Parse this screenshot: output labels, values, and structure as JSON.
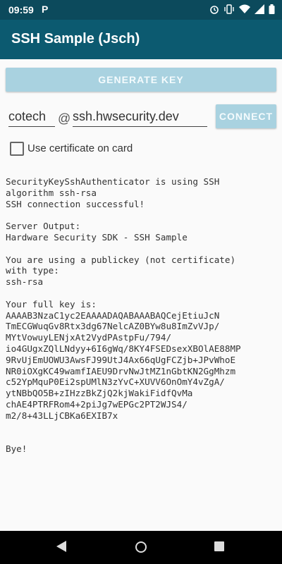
{
  "status": {
    "time": "09:59",
    "app_icon": "P",
    "icons": [
      "alarm-icon",
      "vibrate-icon",
      "wifi-icon",
      "signal-icon",
      "battery-icon"
    ]
  },
  "appbar": {
    "title": "SSH Sample (Jsch)"
  },
  "buttons": {
    "generate": "GENERATE KEY",
    "connect": "CONNECT"
  },
  "form": {
    "username": "cotech",
    "at": "@",
    "host": "ssh.hwsecurity.dev",
    "checkbox_label": "Use certificate on card",
    "checkbox_checked": false
  },
  "output": "SecurityKeySshAuthenticator is using SSH\nalgorithm ssh-rsa\nSSH connection successful!\n\nServer Output:\nHardware Security SDK - SSH Sample\n\nYou are using a publickey (not certificate)\nwith type:\nssh-rsa\n\nYour full key is:\nAAAAB3NzaC1yc2EAAAADAQABAAABAQCejEtiuJcN\nTmECGWuqGv8Rtx3dg67NelcAZ0BYw8u8ImZvVJp/\nMYtVowuyLENjxAt2VydPAstpFu/794/\nio4GUgxZQlLNdyy+6I6gWq/8KY4FSEDsexXBOlAE88MP\n9RvUjEmUOWU3AwsFJ99UtJ4Ax66qUgFCZjb+JPvWhoE\nNR0iOXgKC49wamfIAEU9DrvNwJtMZ1nGbtKN2GgMhzm\nc52YpMquP0Ei2spUMlN3zYvC+XUVV6OnOmY4vZgA/\nytNBbQO5B+zIHzzBkZjQ2kjWakiFidfQvMa\nchAE4PTRFRom4+2piJg7wEPGc2PT2WJS4/\nm2/8+43LLjCBKa6EXIB7x\n\n\nBye!",
  "colors": {
    "statusbar": "#0c4a5c",
    "appbar": "#0c5a70",
    "button": "#a9d2e0"
  }
}
